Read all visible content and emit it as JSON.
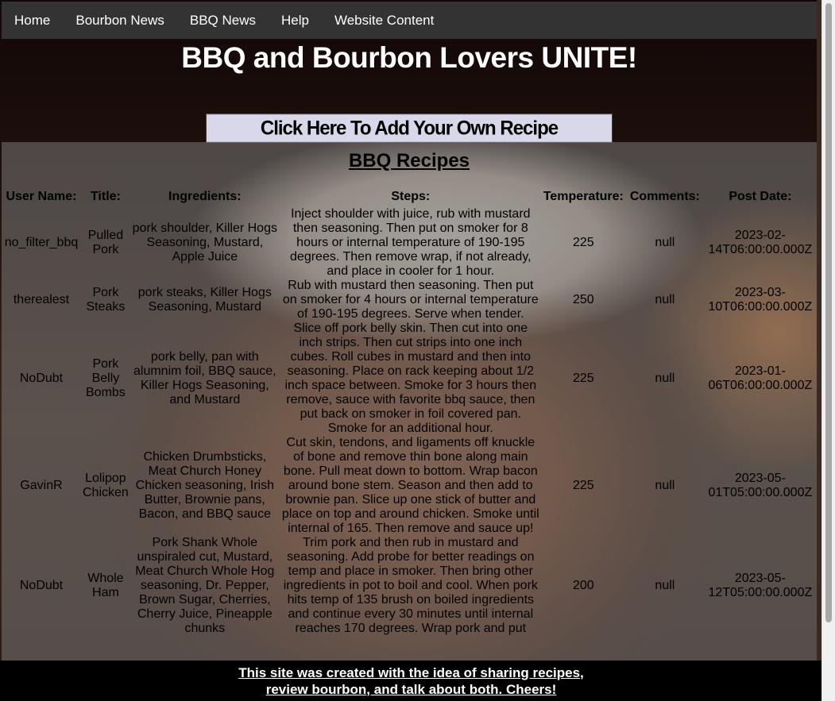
{
  "nav": {
    "items": [
      "Home",
      "Bourbon News",
      "BBQ News",
      "Help",
      "Website Content"
    ]
  },
  "header": {
    "title": "BBQ and Bourbon Lovers UNITE!"
  },
  "add_recipe_label": "Click Here To Add Your Own Recipe",
  "recipes": {
    "heading": "BBQ Recipes",
    "columns": [
      "User Name:",
      "Title:",
      "Ingredients:",
      "Steps:",
      "Temperature:",
      "Comments:",
      "Post Date:"
    ],
    "rows": [
      {
        "user": "no_filter_bbq",
        "title": "Pulled Pork",
        "ingredients": "pork shoulder, Killer Hogs Seasoning, Mustard, Apple Juice",
        "steps": "Inject shoulder with juice, rub with mustard then seasoning. Then put on smoker for 8 hours or internal temperature of 190-195 degrees. Then remove wrap, if not already, and place in cooler for 1 hour.",
        "temperature": "225",
        "comments": "null",
        "post_date": "2023-02-14T06:00:00.000Z"
      },
      {
        "user": "therealest",
        "title": "Pork Steaks",
        "ingredients": "pork steaks, Killer Hogs Seasoning, Mustard",
        "steps": "Rub with mustard then seasoning. Then put on smoker for 4 hours or internal temperature of 190-195 degrees. Serve when tender.",
        "temperature": "250",
        "comments": "null",
        "post_date": "2023-03-10T06:00:00.000Z"
      },
      {
        "user": "NoDubt",
        "title": "Pork Belly Bombs",
        "ingredients": "pork belly, pan with alumnim foil, BBQ sauce, Killer Hogs Seasoning, and Mustard",
        "steps": "Slice off pork belly skin. Then cut into one inch strips. Then cut strips into one inch cubes. Roll cubes in mustard and then into seasoning. Place on rack keeping about 1/2 inch space between. Smoke for 3 hours then remove, sauce with favorite bbq sauce, then put back on smoker in foil covered pan. Smoke for an additional hour.",
        "temperature": "225",
        "comments": "null",
        "post_date": "2023-01-06T06:00:00.000Z"
      },
      {
        "user": "GavinR",
        "title": "Lolipop Chicken",
        "ingredients": "Chicken Drumbsticks, Meat Church Honey Chicken seasoning, Irish Butter, Brownie pans, Bacon, and BBQ sauce",
        "steps": "Cut skin, tendons, and ligaments off knuckle of bone and remove thin bone along main bone. Pull meat down to bottom. Wrap bacon around bone stem. Season and then add to brownie pan. Slice up one stick of butter and place on top and around chicken. Smoke until internal of 165. Then remove and sauce up!",
        "temperature": "225",
        "comments": "null",
        "post_date": "2023-05-01T05:00:00.000Z"
      },
      {
        "user": "NoDubt",
        "title": "Whole Ham",
        "ingredients": "Pork Shank Whole unspiraled cut, Mustard, Meat Church Whole Hog seasoning, Dr. Pepper, Brown Sugar, Cherries, Cherry Juice, Pineapple chunks",
        "steps": "Trim pork and then rub in mustard and seasoning. Add probe for better readings on temp and place in smoker. Then bring other ingredients in pot to boil and cool. When pork hits temp of 135 brush on boiled ingredients and continue every 30 minutes until internal reaches 170 degrees. Wrap pork and put",
        "temperature": "200",
        "comments": "null",
        "post_date": "2023-05-12T05:00:00.000Z"
      }
    ]
  },
  "footer": {
    "line1": "This site was created with the idea of sharing recipes,",
    "line2": "review bourbon, and talk about both. Cheers!"
  }
}
